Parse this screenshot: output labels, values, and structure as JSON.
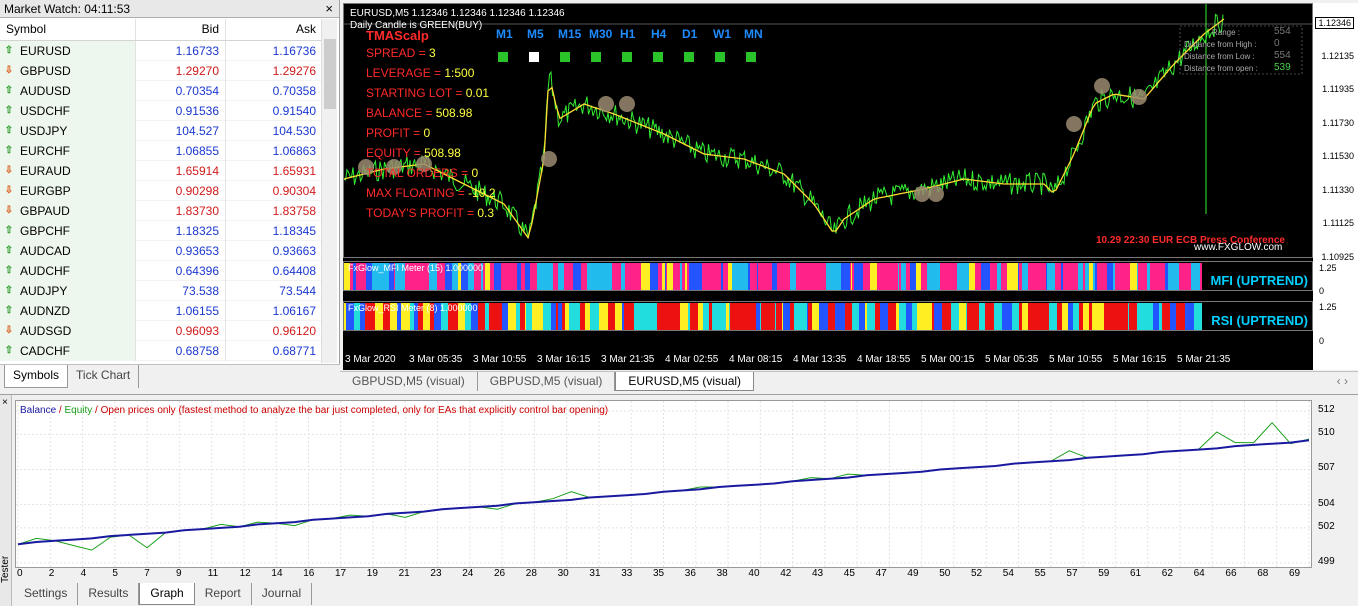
{
  "market_watch": {
    "title": "Market Watch: 04:11:53",
    "headers": {
      "symbol": "Symbol",
      "bid": "Bid",
      "ask": "Ask"
    },
    "rows": [
      {
        "symbol": "EURUSD",
        "bid": "1.16733",
        "ask": "1.16736",
        "dir": "up",
        "color": "blue"
      },
      {
        "symbol": "GBPUSD",
        "bid": "1.29270",
        "ask": "1.29276",
        "dir": "down",
        "color": "red"
      },
      {
        "symbol": "AUDUSD",
        "bid": "0.70354",
        "ask": "0.70358",
        "dir": "up",
        "color": "blue"
      },
      {
        "symbol": "USDCHF",
        "bid": "0.91536",
        "ask": "0.91540",
        "dir": "up",
        "color": "blue"
      },
      {
        "symbol": "USDJPY",
        "bid": "104.527",
        "ask": "104.530",
        "dir": "up",
        "color": "blue"
      },
      {
        "symbol": "EURCHF",
        "bid": "1.06855",
        "ask": "1.06863",
        "dir": "up",
        "color": "blue"
      },
      {
        "symbol": "EURAUD",
        "bid": "1.65914",
        "ask": "1.65931",
        "dir": "down",
        "color": "red"
      },
      {
        "symbol": "EURGBP",
        "bid": "0.90298",
        "ask": "0.90304",
        "dir": "down",
        "color": "red"
      },
      {
        "symbol": "GBPAUD",
        "bid": "1.83730",
        "ask": "1.83758",
        "dir": "down",
        "color": "red"
      },
      {
        "symbol": "GBPCHF",
        "bid": "1.18325",
        "ask": "1.18345",
        "dir": "up",
        "color": "blue"
      },
      {
        "symbol": "AUDCAD",
        "bid": "0.93653",
        "ask": "0.93663",
        "dir": "up",
        "color": "blue"
      },
      {
        "symbol": "AUDCHF",
        "bid": "0.64396",
        "ask": "0.64408",
        "dir": "up",
        "color": "blue"
      },
      {
        "symbol": "AUDJPY",
        "bid": "73.538",
        "ask": "73.544",
        "dir": "up",
        "color": "blue"
      },
      {
        "symbol": "AUDNZD",
        "bid": "1.06155",
        "ask": "1.06167",
        "dir": "up",
        "color": "blue"
      },
      {
        "symbol": "AUDSGD",
        "bid": "0.96093",
        "ask": "0.96120",
        "dir": "down",
        "color": "red"
      },
      {
        "symbol": "CADCHF",
        "bid": "0.68758",
        "ask": "0.68771",
        "dir": "up",
        "color": "blue"
      }
    ],
    "tabs": [
      "Symbols",
      "Tick Chart"
    ],
    "close": "×"
  },
  "chart": {
    "symbol_line": "EURUSD,M5  1.12346 1.12346 1.12346 1.12346",
    "candle_line": "Daily Candle is GREEN(BUY)",
    "ea_name": "TMAScalp",
    "info": [
      {
        "k": "SPREAD = ",
        "v": "3"
      },
      {
        "k": "LEVERAGE = ",
        "v": "1:500"
      },
      {
        "k": "STARTING LOT = ",
        "v": "0.01"
      },
      {
        "k": "BALANCE = ",
        "v": "508.98"
      },
      {
        "k": "PROFIT = ",
        "v": "0"
      },
      {
        "k": "EQUITY = ",
        "v": "508.98"
      },
      {
        "k": "TOTAL ORDERS = ",
        "v": "0"
      },
      {
        "k": "MAX FLOATING = ",
        "v": "-10.2"
      },
      {
        "k": "TODAY'S PROFIT = ",
        "v": "0.3"
      }
    ],
    "timeframes": [
      "M1",
      "M5",
      "M15",
      "M30",
      "H1",
      "H4",
      "D1",
      "W1",
      "MN"
    ],
    "range_panel": [
      {
        "label": "Range :",
        "value": "554"
      },
      {
        "label": "Distance from High :",
        "value": "0"
      },
      {
        "label": "Distance from Low :",
        "value": "554"
      },
      {
        "label": "Distance from open :",
        "value": "539"
      }
    ],
    "price_ticks": [
      "1.12346",
      "1.12135",
      "1.11935",
      "1.11730",
      "1.11530",
      "1.11330",
      "1.11125",
      "1.10925"
    ],
    "news": "10.29 22:30 EUR ECB Press Conference",
    "brand": "www.FXGLOW.com",
    "mfi": {
      "label": "FxGlow_MFI Meter (15) 1.000000",
      "name": "MFI (UPTREND)",
      "top": "1.25",
      "bottom": "0"
    },
    "rsi": {
      "label": "FxGlow_RSI Meter (8) 1.000000",
      "name": "RSI (UPTREND)",
      "top": "1.25",
      "bottom": "0"
    },
    "time_ticks": [
      "3 Mar 2020",
      "3 Mar 05:35",
      "3 Mar 10:55",
      "3 Mar 16:15",
      "3 Mar 21:35",
      "4 Mar 02:55",
      "4 Mar 08:15",
      "4 Mar 13:35",
      "4 Mar 18:55",
      "5 Mar 00:15",
      "5 Mar 05:35",
      "5 Mar 10:55",
      "5 Mar 16:15",
      "5 Mar 21:35"
    ],
    "tabs": [
      "GBPUSD,M5 (visual)",
      "GBPUSD,M5 (visual)",
      "EURUSD,M5 (visual)"
    ],
    "nav": "‹ ›"
  },
  "tester": {
    "side_label": "Tester",
    "close": "×",
    "legend": {
      "balance": "Balance",
      "sep1": " / ",
      "equity": "Equity",
      "sep2": " / ",
      "mode": "Open prices only (fastest method to analyze the bar just completed, only for EAs that explicitly control bar opening)"
    },
    "tabs": [
      "Settings",
      "Results",
      "Graph",
      "Report",
      "Journal"
    ],
    "active_tab": "Graph",
    "colors": {
      "balance": "#1a1aa0",
      "equity": "#1aa01a"
    }
  },
  "chart_data": {
    "type": "line",
    "ylim": [
      499,
      512
    ],
    "y_ticks": [
      "512",
      "510",
      "507",
      "504",
      "502",
      "499"
    ],
    "x_ticks": [
      "0",
      "2",
      "4",
      "5",
      "7",
      "9",
      "11",
      "12",
      "14",
      "16",
      "17",
      "19",
      "21",
      "23",
      "24",
      "26",
      "28",
      "30",
      "31",
      "33",
      "35",
      "36",
      "38",
      "40",
      "42",
      "43",
      "45",
      "47",
      "49",
      "50",
      "52",
      "54",
      "55",
      "57",
      "59",
      "61",
      "62",
      "64",
      "66",
      "68",
      "69"
    ],
    "x": [
      0,
      1,
      2,
      3,
      4,
      5,
      6,
      7,
      8,
      9,
      10,
      11,
      12,
      13,
      14,
      15,
      16,
      17,
      18,
      19,
      20,
      21,
      22,
      23,
      24,
      25,
      26,
      27,
      28,
      29,
      30,
      31,
      32,
      33,
      34,
      35,
      36,
      37,
      38,
      39,
      40,
      41,
      42,
      43,
      44,
      45,
      46,
      47,
      48,
      49,
      50,
      51,
      52,
      53,
      54,
      55,
      56,
      57,
      58,
      59,
      60,
      61,
      62,
      63,
      64,
      65,
      66,
      67,
      68,
      69,
      70
    ],
    "series": [
      {
        "name": "Balance",
        "values": [
          500.6,
          500.8,
          500.9,
          501.0,
          501.1,
          501.3,
          501.4,
          501.5,
          501.6,
          501.8,
          501.9,
          502.0,
          502.1,
          502.3,
          502.4,
          502.5,
          502.7,
          502.8,
          502.9,
          503.0,
          503.2,
          503.3,
          503.4,
          503.6,
          503.7,
          503.8,
          503.9,
          504.1,
          504.2,
          504.3,
          504.4,
          504.6,
          504.7,
          504.8,
          504.9,
          505.1,
          505.2,
          505.3,
          505.5,
          505.6,
          505.7,
          505.8,
          506.0,
          506.1,
          506.2,
          506.3,
          506.5,
          506.6,
          506.7,
          506.8,
          507.0,
          507.1,
          507.2,
          507.3,
          507.5,
          507.6,
          507.7,
          507.8,
          508.0,
          508.1,
          508.2,
          508.3,
          508.5,
          508.6,
          508.7,
          508.8,
          509.0,
          509.1,
          509.2,
          509.3,
          509.5
        ]
      },
      {
        "name": "Equity",
        "values": [
          500.6,
          501.1,
          500.9,
          500.5,
          500.1,
          501.2,
          501.4,
          500.3,
          501.6,
          501.8,
          501.9,
          502.3,
          502.1,
          502.5,
          502.4,
          502.2,
          502.7,
          502.8,
          503.1,
          503.0,
          503.2,
          502.9,
          503.4,
          503.6,
          503.7,
          503.8,
          503.6,
          504.1,
          504.2,
          504.5,
          505.1,
          504.6,
          504.7,
          504.8,
          504.9,
          505.1,
          505.2,
          505.5,
          505.5,
          505.6,
          505.7,
          505.8,
          506.0,
          506.3,
          506.2,
          506.6,
          506.5,
          506.6,
          506.7,
          506.8,
          507.0,
          507.1,
          507.2,
          507.3,
          507.5,
          507.6,
          507.7,
          508.6,
          508.0,
          508.1,
          508.2,
          508.3,
          508.5,
          508.6,
          508.7,
          510.2,
          509.3,
          509.3,
          511.0,
          509.2,
          509.6
        ]
      }
    ]
  }
}
